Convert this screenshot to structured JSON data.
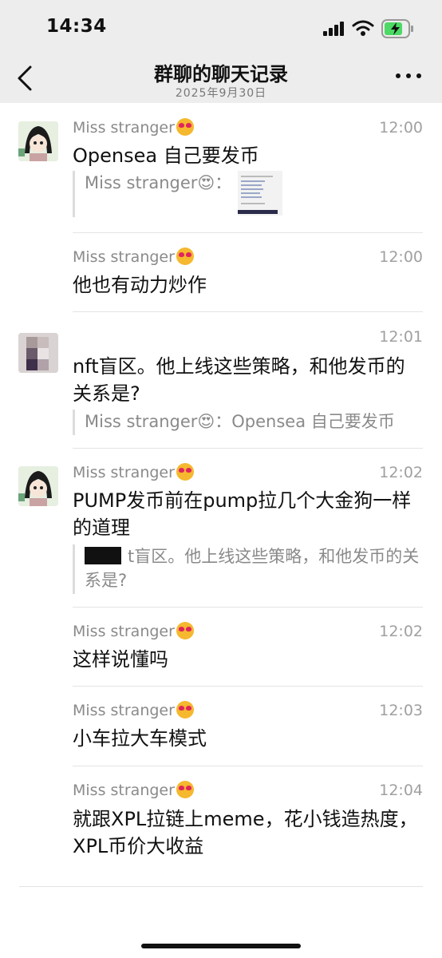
{
  "status_bar": {
    "time": "14:34"
  },
  "nav": {
    "title": "群聊的聊天记录",
    "date": "2025年9月30日"
  },
  "messages": [
    {
      "sender": "Miss stranger",
      "time": "12:00",
      "content": "Opensea 自己要发币",
      "quote": "Miss stranger😍："
    },
    {
      "sender": "Miss stranger",
      "time": "12:00",
      "content": "他也有动力炒作"
    },
    {
      "sender": "",
      "time": "12:01",
      "content": "nft盲区。他上线这些策略，和他发币的关系是?",
      "quote": "Miss stranger😍：Opensea 自己要发币"
    },
    {
      "sender": "Miss stranger",
      "time": "12:02",
      "content": "PUMP发币前在pump拉几个大金狗一样的道理",
      "quote": "t盲区。他上线这些策略，和他发币的关系是?"
    },
    {
      "sender": "Miss stranger",
      "time": "12:02",
      "content": "这样说懂吗"
    },
    {
      "sender": "Miss stranger",
      "time": "12:03",
      "content": "小车拉大车模式"
    },
    {
      "sender": "Miss stranger",
      "time": "12:04",
      "content": "就跟XPL拉链上meme，花小钱造热度，XPL币价大收益"
    }
  ],
  "colors": {
    "header_bg": "#ededed",
    "accent_emoji": "#f5b82e"
  }
}
